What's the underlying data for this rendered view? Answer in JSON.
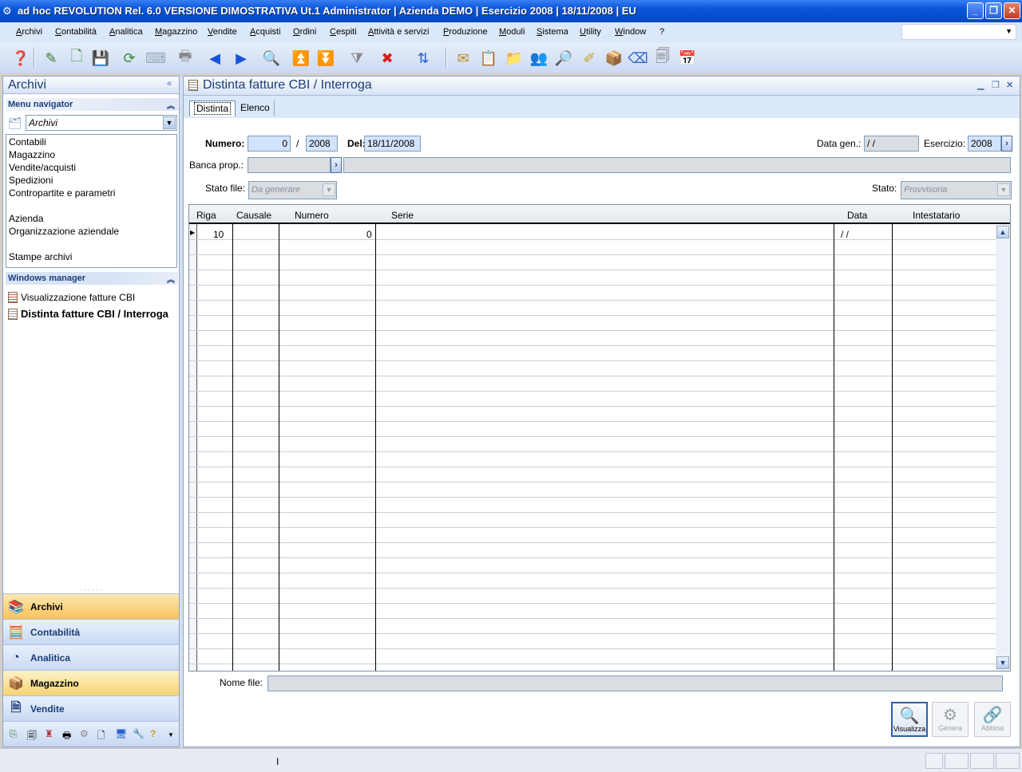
{
  "window": {
    "title": "ad hoc REVOLUTION Rel. 6.0 VERSIONE DIMOSTRATIVA Ut.1 Administrator | Azienda DEMO | Esercizio 2008 | 18/11/2008 | EU",
    "minimize": "_",
    "restore": "❐",
    "close": "✕"
  },
  "menu": [
    "Archivi",
    "Contabilità",
    "Analitica",
    "Magazzino",
    "Vendite",
    "Acquisti",
    "Ordini",
    "Cespiti",
    "Attività e servizi",
    "Produzione",
    "Moduli",
    "Sistema",
    "Utility",
    "Window",
    "?"
  ],
  "toolbar_icons": [
    "help-icon",
    "edit-icon",
    "new-icon",
    "save-icon",
    "refresh-icon",
    "keyboard-icon",
    "print-icon",
    "prev-icon",
    "next-icon",
    "preview-icon",
    "first-icon",
    "last-icon",
    "filter-icon",
    "delete-icon",
    "zoom-icon",
    "notes-icon",
    "clipboard-icon",
    "folder-icon",
    "users-icon",
    "search-icon",
    "marker-icon",
    "box-icon",
    "eraser-icon",
    "documents-icon",
    "calendar-icon"
  ],
  "left": {
    "title": "Archivi",
    "collapse": "«",
    "menu_navigator": "Menu navigator",
    "nav_combo": "Archivi",
    "nav_items": [
      "Contabili",
      "Magazzino",
      "Vendite/acquisti",
      "Spedizioni",
      "Contropartite e parametri",
      "",
      "Azienda",
      "Organizzazione aziendale",
      "",
      "Stampe archivi"
    ],
    "windows_manager": "Windows manager",
    "windows": [
      "Visualizzazione fatture CBI",
      "Distinta fatture CBI / Interroga"
    ],
    "sections": [
      "Archivi",
      "Contabilità",
      "Analitica",
      "Magazzino",
      "Vendite"
    ]
  },
  "main": {
    "title": "Distinta fatture CBI / Interroga",
    "tabs": [
      "Distinta",
      "Elenco"
    ],
    "numero_label": "Numero:",
    "numero": "0",
    "slash": "/",
    "anno": "2008",
    "del_label": "Del:",
    "del": "18/11/2008",
    "data_gen_label": "Data gen.:",
    "data_gen": "/ /",
    "esercizio_label": "Esercizio:",
    "esercizio": "2008",
    "banca_label": "Banca prop.:",
    "stato_file_label": "Stato file:",
    "stato_file": "Da generare",
    "stato_label": "Stato:",
    "stato": "Provvisoria",
    "columns": [
      "Riga",
      "Causale",
      "Numero",
      "Serie",
      "Data",
      "Intestatario"
    ],
    "row": {
      "riga": "10",
      "numero": "0",
      "data": "/ /"
    },
    "nome_file_label": "Nome file:",
    "buttons": [
      "Visualizza",
      "Genera",
      "Abbina"
    ]
  },
  "status": {
    "text": "I"
  }
}
